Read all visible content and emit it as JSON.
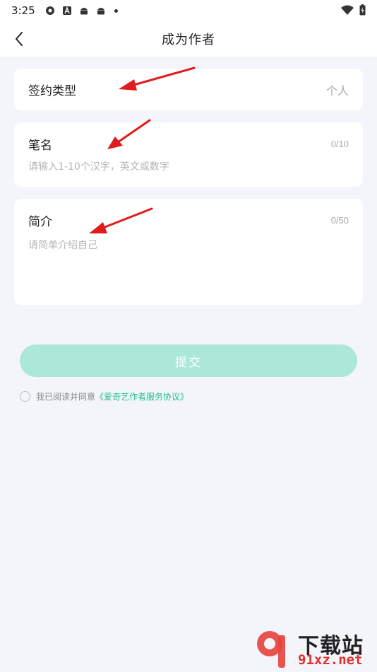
{
  "status_bar": {
    "time": "3:25"
  },
  "nav": {
    "title": "成为作者"
  },
  "sign_type": {
    "label": "签约类型",
    "value": "个人"
  },
  "pen_name": {
    "label": "笔名",
    "counter": "0/10",
    "placeholder": "请输入1-10个汉字，英文或数字"
  },
  "intro": {
    "label": "简介",
    "counter": "0/50",
    "placeholder": "请简单介绍自己"
  },
  "submit": {
    "label": "提交"
  },
  "agreement": {
    "prefix": "我已阅读并同意",
    "link": "《爱奇艺作者服务协议》"
  },
  "watermark": {
    "text": "下载站",
    "url": "91xz.net"
  },
  "colors": {
    "accent": "#1fbf8f",
    "button": "#abe8d9",
    "arrow": "#e01b1b",
    "background": "#f4f5fa"
  }
}
